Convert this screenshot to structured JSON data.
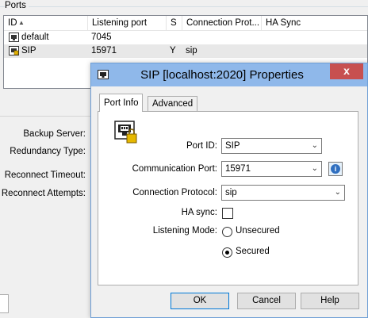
{
  "ports_group": {
    "label": "Ports"
  },
  "ports_table": {
    "columns": [
      "ID",
      "Listening port",
      "S",
      "Connection Prot...",
      "HA Sync"
    ],
    "rows": [
      {
        "id": "default",
        "listening_port": "7045",
        "s": "",
        "connection_protocol": "",
        "ha_sync": ""
      },
      {
        "id": "SIP",
        "listening_port": "15971",
        "s": "Y",
        "connection_protocol": "sip",
        "ha_sync": ""
      }
    ]
  },
  "left_panel": {
    "labels": [
      "Backup Server:",
      "Redundancy Type:",
      "Reconnect Timeout:",
      "Reconnect Attempts:"
    ]
  },
  "dialog": {
    "title": "SIP [localhost:2020] Properties",
    "close_glyph": "x",
    "tabs": [
      "Port Info",
      "Advanced"
    ],
    "active_tab": "Port Info",
    "fields": {
      "port_id_label": "Port ID:",
      "port_id_value": "SIP",
      "comm_port_label": "Communication Port:",
      "comm_port_value": "15971",
      "conn_protocol_label": "Connection Protocol:",
      "conn_protocol_value": "sip",
      "ha_sync_label": "HA sync:",
      "ha_sync_checked": false,
      "listening_mode_label": "Listening Mode:",
      "mode_unsecured": "Unsecured",
      "mode_secured": "Secured",
      "selected_mode": "Secured"
    },
    "buttons": {
      "ok": "OK",
      "cancel": "Cancel",
      "help": "Help"
    }
  },
  "colors": {
    "titlebar": "#8fb8ea",
    "close_button": "#c75050",
    "window_bg": "#f0f0f0",
    "info_icon": "#2f6fc0"
  }
}
